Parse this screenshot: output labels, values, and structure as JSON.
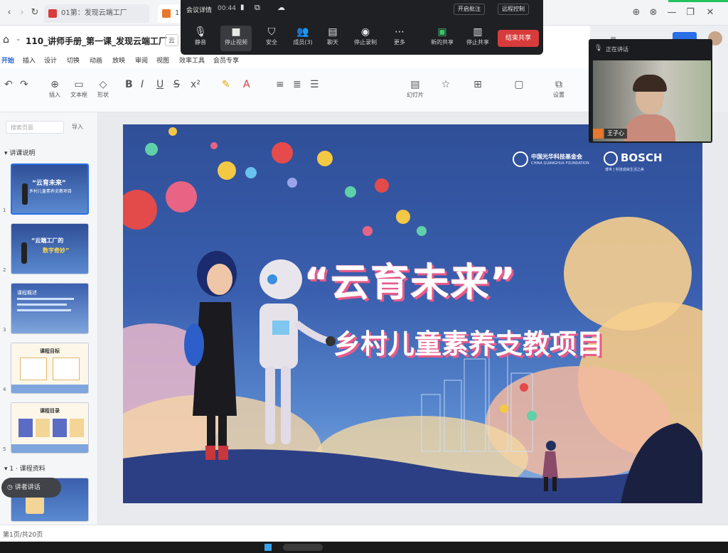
{
  "browser": {
    "tab1": "01第：发现云端工厂",
    "tab2": "11"
  },
  "meeting": {
    "title": "会议详情",
    "time": "00:44",
    "top_right_1": "开启批注",
    "top_right_2": "远程控制",
    "buttons": [
      "静音",
      "停止视频",
      "安全",
      "成员(3)",
      "聊天",
      "停止录制",
      "更多",
      "新的共享",
      "停止共享"
    ],
    "end_share": "结束共享"
  },
  "doc": {
    "title": "110_讲师手册_第一课_发现云端工厂",
    "chip": "云",
    "menus": [
      "开始",
      "插入",
      "设计",
      "切换",
      "动画",
      "放映",
      "审阅",
      "视图",
      "效率工具",
      "会员专享"
    ],
    "ribbon": [
      "插入",
      "文本框",
      "形状",
      "幻灯片",
      "排列",
      "设置"
    ],
    "search_placeholder": "搜索页面",
    "search_btn": "导入"
  },
  "sidebar": {
    "section1": "讲课说明",
    "section2": "1 · 课程资料",
    "thumb1_title": "“云育未来”",
    "thumb1_sub": "乡村儿童素养支教项目",
    "thumb2_title": "“云端工厂的",
    "thumb2_sub": "数字奇妙”",
    "thumb3": "课程概述",
    "thumb4": "课程目标",
    "thumb5": "课程目录",
    "voice_chip": "讲者讲话"
  },
  "slide": {
    "logo1": "中国光华科技基金会",
    "logo1_sub": "CHINA GUANGHUA FOUNDATION",
    "logo2": "BOSCH",
    "logo2_sub": "博世 | 科技成就生活之美",
    "headline": "“云育未来”",
    "subtitle": "乡村儿童素养支教项目"
  },
  "video": {
    "status": "正在讲话",
    "name": "王子心"
  },
  "status": {
    "page": "第1页/共20页"
  },
  "colors": {
    "accent": "#d83b3b",
    "slide_bg": "#3a5fae"
  }
}
